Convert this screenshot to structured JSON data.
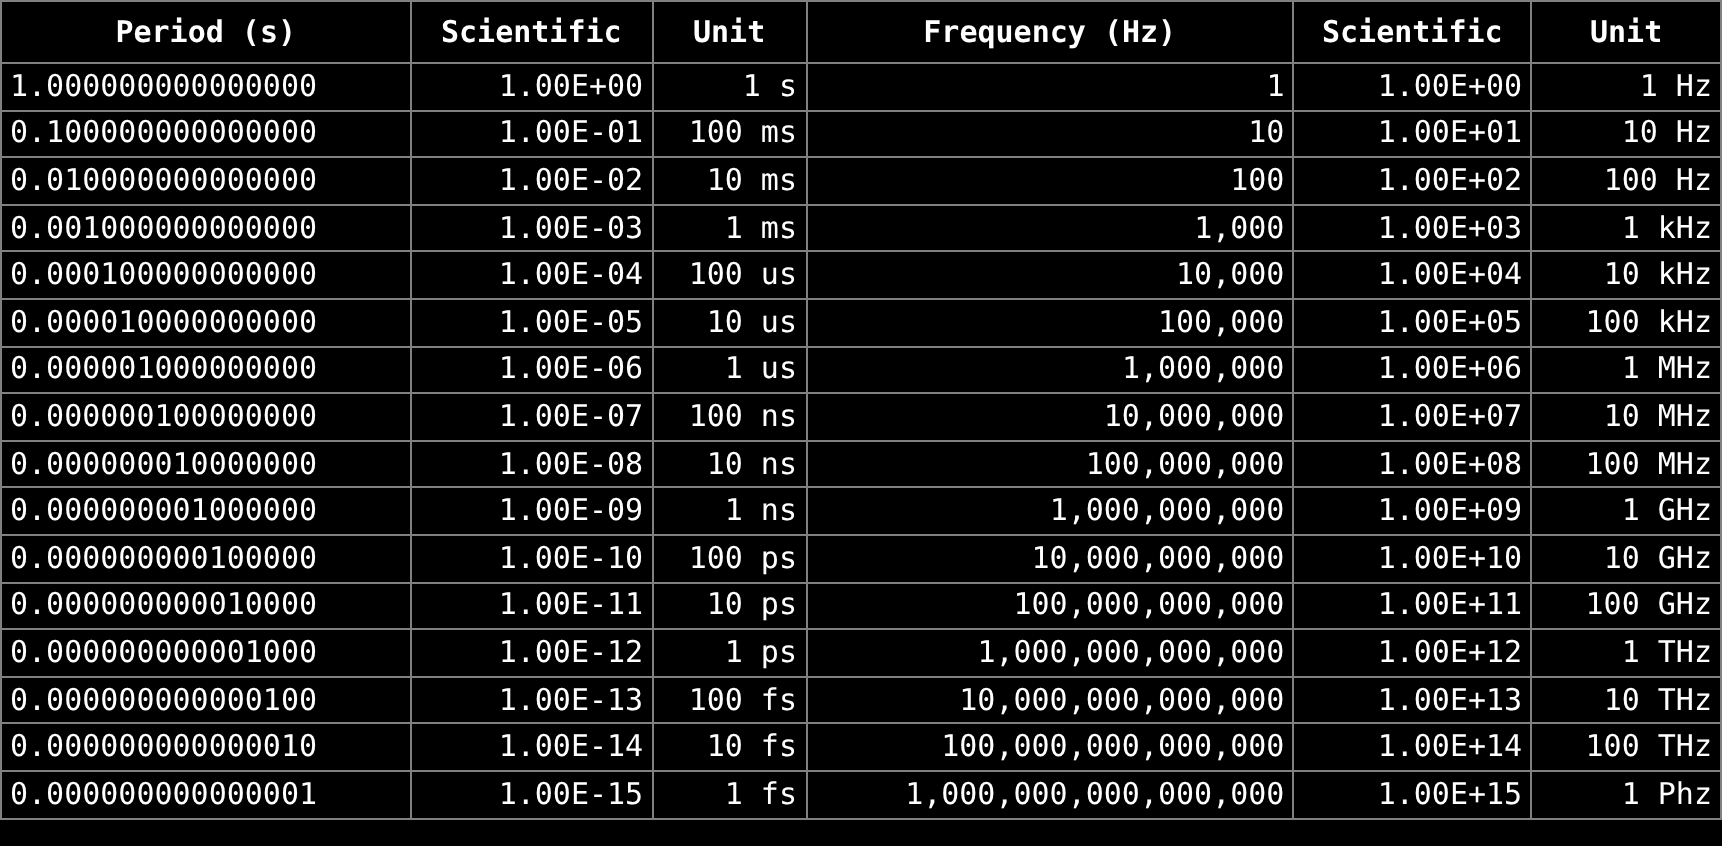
{
  "table": {
    "columns": [
      "Period (s)",
      "Scientific",
      "Unit",
      "Frequency (Hz)",
      "Scientific",
      "Unit"
    ],
    "rows": [
      [
        "1.000000000000000",
        "1.00E+00",
        "1 s",
        "1",
        "1.00E+00",
        "1 Hz"
      ],
      [
        "0.100000000000000",
        "1.00E-01",
        "100 ms",
        "10",
        "1.00E+01",
        "10 Hz"
      ],
      [
        "0.010000000000000",
        "1.00E-02",
        "10 ms",
        "100",
        "1.00E+02",
        "100 Hz"
      ],
      [
        "0.001000000000000",
        "1.00E-03",
        "1 ms",
        "1,000",
        "1.00E+03",
        "1 kHz"
      ],
      [
        "0.000100000000000",
        "1.00E-04",
        "100 us",
        "10,000",
        "1.00E+04",
        "10 kHz"
      ],
      [
        "0.000010000000000",
        "1.00E-05",
        "10 us",
        "100,000",
        "1.00E+05",
        "100 kHz"
      ],
      [
        "0.000001000000000",
        "1.00E-06",
        "1 us",
        "1,000,000",
        "1.00E+06",
        "1 MHz"
      ],
      [
        "0.000000100000000",
        "1.00E-07",
        "100 ns",
        "10,000,000",
        "1.00E+07",
        "10 MHz"
      ],
      [
        "0.000000010000000",
        "1.00E-08",
        "10 ns",
        "100,000,000",
        "1.00E+08",
        "100 MHz"
      ],
      [
        "0.000000001000000",
        "1.00E-09",
        "1 ns",
        "1,000,000,000",
        "1.00E+09",
        "1 GHz"
      ],
      [
        "0.000000000100000",
        "1.00E-10",
        "100 ps",
        "10,000,000,000",
        "1.00E+10",
        "10 GHz"
      ],
      [
        "0.000000000010000",
        "1.00E-11",
        "10 ps",
        "100,000,000,000",
        "1.00E+11",
        "100 GHz"
      ],
      [
        "0.000000000001000",
        "1.00E-12",
        "1 ps",
        "1,000,000,000,000",
        "1.00E+12",
        "1 THz"
      ],
      [
        "0.000000000000100",
        "1.00E-13",
        "100 fs",
        "10,000,000,000,000",
        "1.00E+13",
        "10 THz"
      ],
      [
        "0.000000000000010",
        "1.00E-14",
        "10 fs",
        "100,000,000,000,000",
        "1.00E+14",
        "100 THz"
      ],
      [
        "0.000000000000001",
        "1.00E-15",
        "1 fs",
        "1,000,000,000,000,000",
        "1.00E+15",
        "1 Phz"
      ]
    ]
  }
}
